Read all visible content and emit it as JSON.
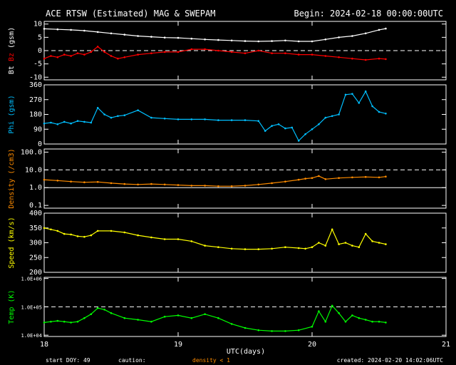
{
  "header": {
    "title": "ACE RTSW (Estimated) MAG & SWEPAM",
    "begin": "Begin: 2024-02-18 00:00:00UTC"
  },
  "footer": {
    "start_doy": "start DOY:  49",
    "caution": "caution:",
    "density_note": "density < 1",
    "created": "created: 2024-02-20 14:02:06UTC"
  },
  "colors": {
    "bt": "#ffffff",
    "bz": "#ff0000",
    "phi": "#00bfff",
    "density": "#ff8c00",
    "speed": "#ffff00",
    "temp": "#00ff00",
    "axes": "#ffffff"
  },
  "chart_data": {
    "type": "scatter",
    "x_label": "UTC(days)",
    "x_ticks": [
      "18",
      "19",
      "20",
      "21"
    ],
    "x_range": [
      18,
      21
    ],
    "panels": [
      {
        "id": "mag",
        "ylabel_parts": [
          "Bt",
          "Bz",
          "(gsm)"
        ],
        "yscale": "linear",
        "yrange": [
          -11,
          11
        ],
        "yticks": [
          "10",
          "5",
          "0",
          "-5",
          "-10"
        ],
        "ytick_values": [
          10,
          5,
          0,
          -5,
          -10
        ],
        "dashed_ref": [
          0
        ],
        "series": [
          {
            "name": "Bt",
            "color": "bt",
            "x": [
              18.0,
              18.1,
              18.2,
              18.3,
              18.4,
              18.5,
              18.6,
              18.7,
              18.8,
              18.9,
              19.0,
              19.1,
              19.2,
              19.3,
              19.4,
              19.5,
              19.6,
              19.7,
              19.8,
              19.9,
              20.0,
              20.1,
              20.2,
              20.3,
              20.4,
              20.5,
              20.55
            ],
            "y": [
              8.2,
              8.0,
              7.8,
              7.5,
              7.0,
              6.5,
              6.0,
              5.5,
              5.2,
              4.9,
              4.8,
              4.5,
              4.2,
              4.0,
              3.8,
              3.6,
              3.5,
              3.6,
              3.8,
              3.5,
              3.5,
              4.2,
              5.0,
              5.5,
              6.5,
              7.8,
              8.3
            ]
          },
          {
            "name": "Bz",
            "color": "bz",
            "x": [
              18.0,
              18.05,
              18.1,
              18.15,
              18.2,
              18.25,
              18.3,
              18.35,
              18.4,
              18.45,
              18.5,
              18.55,
              18.6,
              18.7,
              18.8,
              18.9,
              19.0,
              19.1,
              19.2,
              19.3,
              19.4,
              19.5,
              19.6,
              19.7,
              19.8,
              19.9,
              20.0,
              20.1,
              20.2,
              20.3,
              20.4,
              20.5,
              20.55
            ],
            "y": [
              -3.0,
              -2.0,
              -2.5,
              -1.5,
              -2.0,
              -1.0,
              -1.5,
              -0.5,
              1.5,
              -0.5,
              -2.0,
              -3.0,
              -2.5,
              -1.5,
              -1.0,
              -0.5,
              -0.5,
              0.5,
              0.5,
              0.0,
              -0.5,
              -1.0,
              0.0,
              -1.0,
              -1.0,
              -1.5,
              -1.5,
              -2.0,
              -2.5,
              -3.0,
              -3.5,
              -3.0,
              -3.2
            ]
          }
        ]
      },
      {
        "id": "phi",
        "ylabel_parts": [
          "Phi",
          "(gsm)"
        ],
        "yscale": "linear",
        "yrange": [
          0,
          360
        ],
        "yticks": [
          "360",
          "270",
          "180",
          "90",
          "0"
        ],
        "ytick_values": [
          360,
          270,
          180,
          90,
          0
        ],
        "dashed_ref": [],
        "series": [
          {
            "name": "Phi",
            "color": "phi",
            "x": [
              18.0,
              18.05,
              18.1,
              18.15,
              18.2,
              18.25,
              18.3,
              18.35,
              18.4,
              18.45,
              18.5,
              18.55,
              18.6,
              18.7,
              18.8,
              18.9,
              19.0,
              19.1,
              19.2,
              19.3,
              19.4,
              19.5,
              19.6,
              19.65,
              19.7,
              19.75,
              19.8,
              19.85,
              19.9,
              19.95,
              20.0,
              20.05,
              20.1,
              20.15,
              20.2,
              20.25,
              20.3,
              20.35,
              20.4,
              20.45,
              20.5,
              20.55
            ],
            "y": [
              125,
              130,
              120,
              135,
              125,
              140,
              135,
              130,
              220,
              180,
              160,
              170,
              175,
              205,
              160,
              155,
              150,
              150,
              150,
              145,
              145,
              145,
              140,
              80,
              110,
              120,
              95,
              100,
              20,
              60,
              90,
              120,
              160,
              170,
              180,
              300,
              305,
              250,
              320,
              230,
              195,
              185
            ]
          }
        ]
      },
      {
        "id": "density",
        "ylabel_parts": [
          "Density",
          "(/cm3)"
        ],
        "yscale": "log",
        "yrange": [
          0.07,
          150
        ],
        "yticks": [
          "100.0",
          "10.0",
          "1.0",
          "0.1"
        ],
        "ytick_values": [
          100,
          10,
          1,
          0.1
        ],
        "dashed_ref": [
          10
        ],
        "solid_ref": [
          1
        ],
        "series": [
          {
            "name": "Density",
            "color": "density",
            "x": [
              18.0,
              18.1,
              18.2,
              18.3,
              18.4,
              18.5,
              18.6,
              18.7,
              18.8,
              18.9,
              19.0,
              19.1,
              19.2,
              19.3,
              19.4,
              19.5,
              19.6,
              19.7,
              19.8,
              19.9,
              19.95,
              20.0,
              20.05,
              20.1,
              20.2,
              20.3,
              20.4,
              20.5,
              20.55
            ],
            "y": [
              2.8,
              2.5,
              2.2,
              2.0,
              2.1,
              1.8,
              1.6,
              1.5,
              1.6,
              1.5,
              1.4,
              1.3,
              1.3,
              1.2,
              1.2,
              1.3,
              1.5,
              1.8,
              2.2,
              2.8,
              3.2,
              3.5,
              4.5,
              3.0,
              3.5,
              3.8,
              4.0,
              3.8,
              4.2
            ]
          }
        ]
      },
      {
        "id": "speed",
        "ylabel_parts": [
          "Speed",
          "(km/s)"
        ],
        "yscale": "linear",
        "yrange": [
          200,
          400
        ],
        "yticks": [
          "400",
          "350",
          "300",
          "250",
          "200"
        ],
        "ytick_values": [
          400,
          350,
          300,
          250,
          200
        ],
        "dashed_ref": [],
        "series": [
          {
            "name": "Speed",
            "color": "speed",
            "x": [
              18.0,
              18.05,
              18.1,
              18.15,
              18.2,
              18.25,
              18.3,
              18.35,
              18.4,
              18.5,
              18.6,
              18.7,
              18.8,
              18.9,
              19.0,
              19.1,
              19.2,
              19.3,
              19.4,
              19.5,
              19.6,
              19.7,
              19.8,
              19.9,
              19.95,
              20.0,
              20.05,
              20.1,
              20.15,
              20.2,
              20.25,
              20.3,
              20.35,
              20.4,
              20.45,
              20.5,
              20.55
            ],
            "y": [
              350,
              345,
              340,
              330,
              328,
              322,
              320,
              325,
              340,
              340,
              335,
              325,
              318,
              312,
              312,
              305,
              290,
              285,
              280,
              278,
              278,
              280,
              285,
              282,
              280,
              285,
              300,
              290,
              345,
              295,
              300,
              290,
              285,
              330,
              305,
              300,
              295
            ]
          }
        ]
      },
      {
        "id": "temp",
        "ylabel_parts": [
          "Temp",
          "(K)"
        ],
        "yscale": "log",
        "yrange": [
          9000,
          1100000
        ],
        "yticks": [
          "1.0E+06",
          "1.0E+05",
          "1.0E+04"
        ],
        "ytick_values": [
          1000000,
          100000,
          10000
        ],
        "dashed_ref": [
          100000
        ],
        "series": [
          {
            "name": "Temp",
            "color": "temp",
            "x": [
              18.0,
              18.05,
              18.1,
              18.15,
              18.2,
              18.25,
              18.3,
              18.35,
              18.4,
              18.45,
              18.5,
              18.6,
              18.7,
              18.8,
              18.9,
              19.0,
              19.1,
              19.2,
              19.3,
              19.4,
              19.5,
              19.6,
              19.7,
              19.8,
              19.9,
              20.0,
              20.05,
              20.1,
              20.15,
              20.2,
              20.25,
              20.3,
              20.35,
              20.4,
              20.45,
              20.5,
              20.55
            ],
            "y": [
              28000,
              30000,
              32000,
              30000,
              28000,
              30000,
              40000,
              55000,
              90000,
              80000,
              60000,
              40000,
              35000,
              30000,
              45000,
              50000,
              40000,
              55000,
              40000,
              25000,
              18000,
              15000,
              14000,
              14000,
              15000,
              20000,
              70000,
              30000,
              110000,
              60000,
              30000,
              50000,
              40000,
              35000,
              30000,
              30000,
              28000
            ]
          }
        ]
      }
    ]
  }
}
